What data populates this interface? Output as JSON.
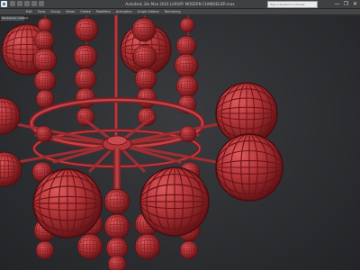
{
  "window": {
    "title": "Autodesk 3ds Max 2016    LUXURY MODERN CHANDELIER.max",
    "controls": [
      "—",
      "❐",
      "✕"
    ]
  },
  "search": {
    "placeholder": "Type a keyword or phrase"
  },
  "menu": {
    "items": [
      "Edit",
      "Tools",
      "Group",
      "Views",
      "Create",
      "Modifiers",
      "Animation",
      "Graph Editors",
      "Rendering"
    ]
  },
  "workspace": {
    "selected": "Workspace: Default"
  },
  "viewport": {
    "model_color": "#b3363a",
    "wire_color": "#6d1215",
    "background": "#2b2d30"
  }
}
